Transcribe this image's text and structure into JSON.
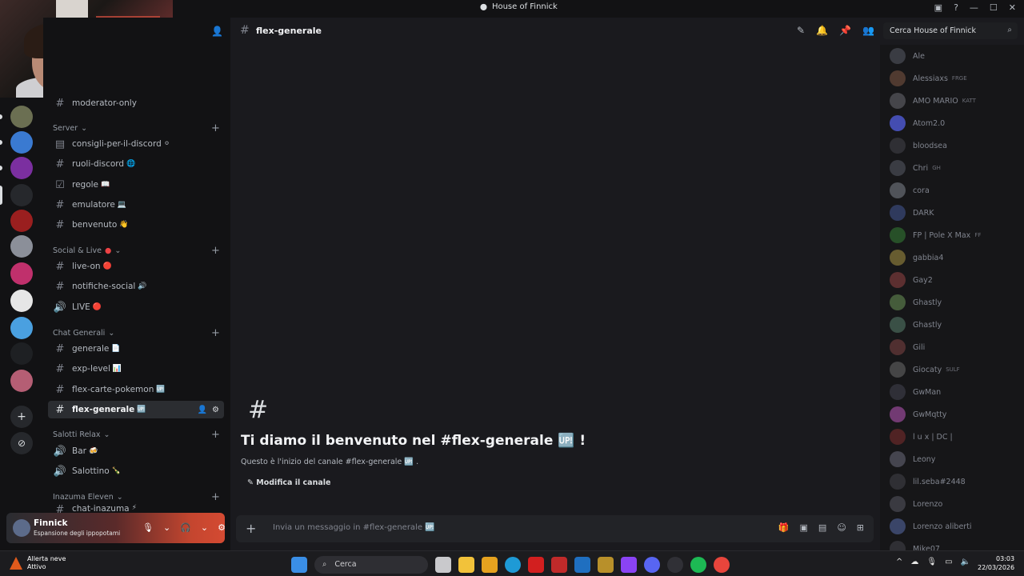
{
  "window": {
    "title": "House of Finnick"
  },
  "server_channels": [
    {
      "label": "moderator-only",
      "emoji": ""
    },
    {
      "label": "consigli-per-il-discord",
      "emoji": "⚪"
    },
    {
      "label": "ruoli-discord",
      "emoji": "🌐"
    },
    {
      "label": "regole",
      "emoji": "📖"
    },
    {
      "label": "emulatore",
      "emoji": "💻"
    },
    {
      "label": "benvenuto",
      "emoji": "👋"
    },
    {
      "label": "live-on",
      "emoji": "🔴"
    },
    {
      "label": "notifiche-social",
      "emoji": "🔊"
    },
    {
      "label": "LIVE",
      "emoji": "🔴"
    },
    {
      "label": "generale",
      "emoji": "📄"
    },
    {
      "label": "exp-level",
      "emoji": "📊"
    },
    {
      "label": "flex-carte-pokemon",
      "emoji": "🆙"
    },
    {
      "label": "flex-generale",
      "emoji": "🆙"
    },
    {
      "label": "Bar",
      "emoji": "🍻"
    },
    {
      "label": "Salottino",
      "emoji": "🍾"
    },
    {
      "label": "chat-inazuma",
      "emoji": "⚡"
    }
  ],
  "categories": {
    "server": "Server",
    "social": "Social & Live",
    "chat": "Chat Generali",
    "salotti": "Salotti Relax",
    "inazuma": "Inazuma Eleven"
  },
  "user": {
    "name": "Finnick",
    "status": "Espansione degli ippopotami"
  },
  "channel": {
    "name": "flex-generale",
    "welcome_title": "Ti diamo il benvenuto nel #flex-generale 🆙 !",
    "welcome_sub": "Questo è l'inizio del canale #flex-generale 🆙 .",
    "edit_label": "Modifica il canale",
    "composer_placeholder": "Invia un messaggio in #flex-generale 🆙"
  },
  "search": {
    "placeholder": "Cerca House of Finnick"
  },
  "members": [
    {
      "name": "Ale",
      "tag": ""
    },
    {
      "name": "Alessiaxs",
      "tag": "FRGE"
    },
    {
      "name": "AMO MARIO",
      "tag": "KATT"
    },
    {
      "name": "Atom2.0",
      "tag": ""
    },
    {
      "name": "bloodsea",
      "tag": ""
    },
    {
      "name": "Chri",
      "tag": "GH"
    },
    {
      "name": "cora",
      "tag": ""
    },
    {
      "name": "DARK",
      "tag": ""
    },
    {
      "name": "FP | Pole X Max",
      "tag": "FF"
    },
    {
      "name": "gabbia4",
      "tag": ""
    },
    {
      "name": "Gay2",
      "tag": ""
    },
    {
      "name": "Ghastly",
      "tag": ""
    },
    {
      "name": "Ghastly",
      "tag": ""
    },
    {
      "name": "Gili",
      "tag": ""
    },
    {
      "name": "Giocaty",
      "tag": "SULF"
    },
    {
      "name": "GwMan",
      "tag": ""
    },
    {
      "name": "GwMqtty",
      "tag": ""
    },
    {
      "name": "l u x | DC |",
      "tag": ""
    },
    {
      "name": "Leony",
      "tag": ""
    },
    {
      "name": "lil.seba#2448",
      "tag": ""
    },
    {
      "name": "Lorenzo",
      "tag": ""
    },
    {
      "name": "Lorenzo aliberti",
      "tag": ""
    },
    {
      "name": "Mike07",
      "tag": ""
    }
  ],
  "taskbar": {
    "weather_title": "Allerta neve",
    "weather_sub": "Attivo",
    "search_label": "Cerca",
    "time": "03:03",
    "date": "22/03/2026"
  },
  "colors": {
    "accent": "#5865f2",
    "live": "#ed4245",
    "user_banner": "#d44a32"
  }
}
